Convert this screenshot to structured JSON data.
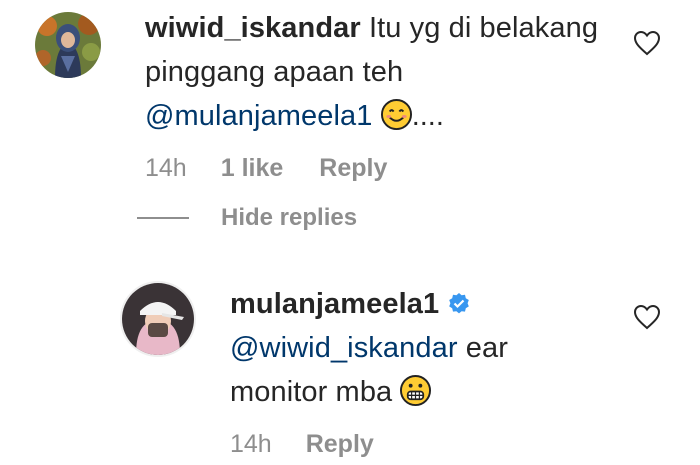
{
  "comment1": {
    "username": "wiwid_iskandar",
    "text_line1": "Itu yg di belakang",
    "text_line2": "pinggang apaan teh",
    "mention": "@mulanjameela1",
    "suffix": "....",
    "time": "14h",
    "likes": "1 like",
    "reply_label": "Reply",
    "avatar_icon": "user-avatar-hijab-icon",
    "emoji_icon": "smiling-face-emoji-icon"
  },
  "hide_replies": {
    "label": "Hide replies"
  },
  "comment2": {
    "username": "mulanjameela1",
    "verified_icon": "verified-badge-icon",
    "mention": "@wiwid_iskandar",
    "text_after_mention": "ear",
    "text_line2": "monitor mba",
    "time": "14h",
    "reply_label": "Reply",
    "avatar_icon": "user-avatar-cap-icon",
    "emoji_icon": "grimacing-face-emoji-icon"
  },
  "colors": {
    "mention": "#00376b",
    "meta_gray": "#8e8e8e",
    "verified_blue": "#3897f0",
    "text": "#262626"
  }
}
